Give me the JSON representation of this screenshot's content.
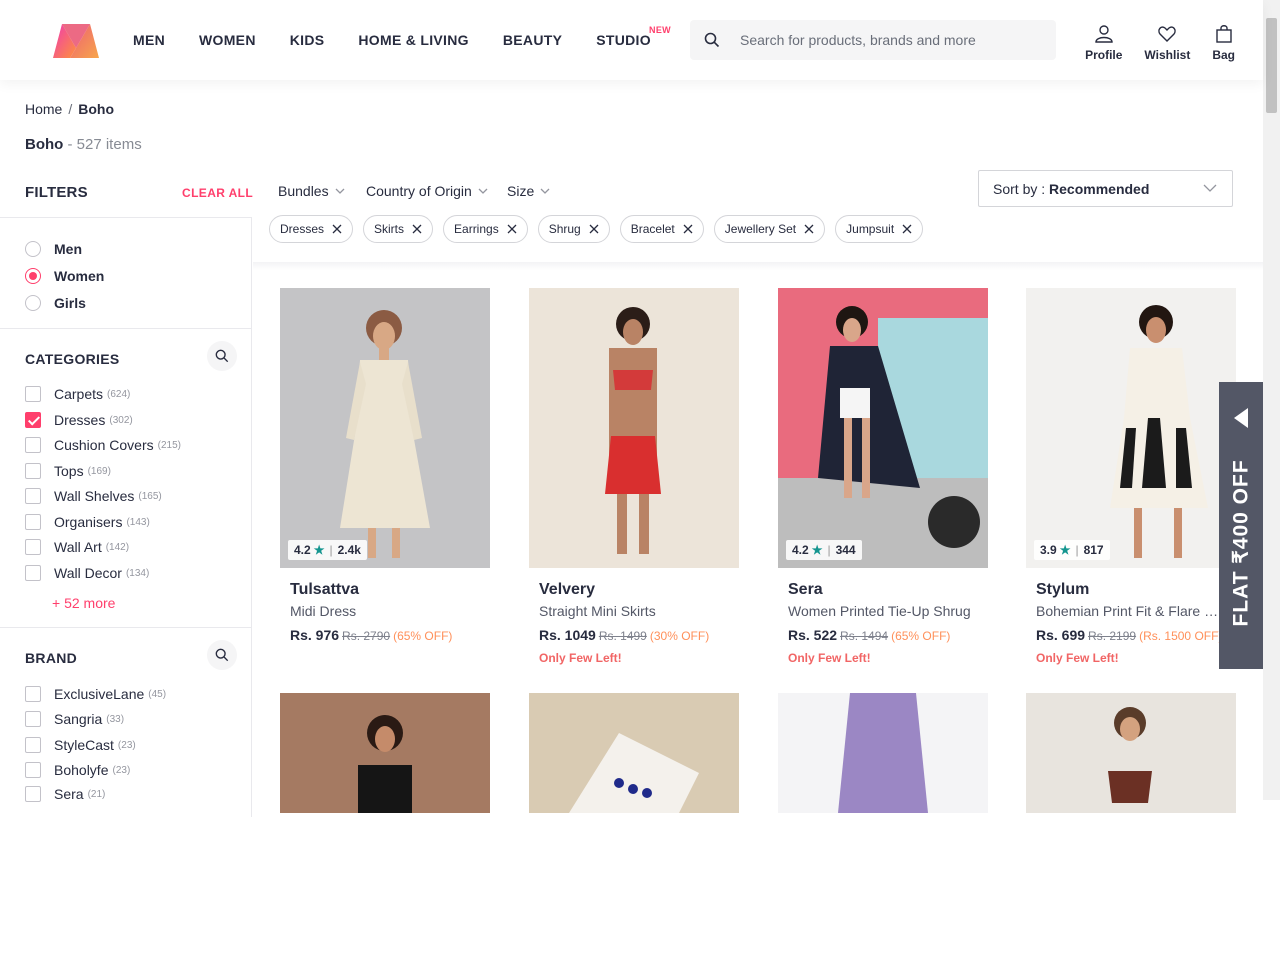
{
  "colors": {
    "accent": "#ff3f6c",
    "rating_star": "#14958f",
    "offer": "#ff905a",
    "low_stock": "#f16565"
  },
  "nav": {
    "items": [
      "MEN",
      "WOMEN",
      "KIDS",
      "HOME & LIVING",
      "BEAUTY",
      "STUDIO"
    ],
    "studio_badge": "NEW"
  },
  "search": {
    "placeholder": "Search for products, brands and more"
  },
  "actions": {
    "profile": "Profile",
    "wishlist": "Wishlist",
    "bag": "Bag"
  },
  "breadcrumb": {
    "home": "Home",
    "separator": "/",
    "current": "Boho"
  },
  "title": {
    "name": "Boho",
    "count": " - 527 items"
  },
  "filters": {
    "heading": "FILTERS",
    "clear_all": "CLEAR ALL"
  },
  "gender": [
    {
      "label": "Men",
      "selected": false
    },
    {
      "label": "Women",
      "selected": true
    },
    {
      "label": "Girls",
      "selected": false
    }
  ],
  "categories": {
    "heading": "CATEGORIES",
    "more": "+ 52 more",
    "items": [
      {
        "label": "Carpets",
        "count": "(624)",
        "checked": false
      },
      {
        "label": "Dresses",
        "count": "(302)",
        "checked": true
      },
      {
        "label": "Cushion Covers",
        "count": "(215)",
        "checked": false
      },
      {
        "label": "Tops",
        "count": "(169)",
        "checked": false
      },
      {
        "label": "Wall Shelves",
        "count": "(165)",
        "checked": false
      },
      {
        "label": "Organisers",
        "count": "(143)",
        "checked": false
      },
      {
        "label": "Wall Art",
        "count": "(142)",
        "checked": false
      },
      {
        "label": "Wall Decor",
        "count": "(134)",
        "checked": false
      }
    ]
  },
  "brand": {
    "heading": "BRAND",
    "items": [
      {
        "label": "ExclusiveLane",
        "count": "(45)"
      },
      {
        "label": "Sangria",
        "count": "(33)"
      },
      {
        "label": "StyleCast",
        "count": "(23)"
      },
      {
        "label": "Boholyfe",
        "count": "(23)"
      },
      {
        "label": "Sera",
        "count": "(21)"
      }
    ]
  },
  "top_filters": [
    "Bundles",
    "Country of Origin",
    "Size"
  ],
  "sort": {
    "label": "Sort by : ",
    "value": "Recommended"
  },
  "chips": [
    "Dresses",
    "Skirts",
    "Earrings",
    "Shrug",
    "Bracelet",
    "Jewellery Set",
    "Jumpsuit"
  ],
  "products": [
    {
      "brand": "Tulsattva",
      "desc": "Midi Dress",
      "price": "Rs. 976",
      "mrp": "Rs. 2790",
      "off": "(65% OFF)",
      "rating": "4.2",
      "reviews": "2.4k",
      "few": ""
    },
    {
      "brand": "Velvery",
      "desc": "Straight Mini Skirts",
      "price": "Rs. 1049",
      "mrp": "Rs. 1499",
      "off": "(30% OFF)",
      "rating": "",
      "reviews": "",
      "few": "Only Few Left!"
    },
    {
      "brand": "Sera",
      "desc": "Women Printed Tie-Up Shrug",
      "price": "Rs. 522",
      "mrp": "Rs. 1494",
      "off": "(65% OFF)",
      "rating": "4.2",
      "reviews": "344",
      "few": "Only Few Left!"
    },
    {
      "brand": "Stylum",
      "desc": "Bohemian Print Fit & Flare Fla...",
      "price": "Rs. 699",
      "mrp": "Rs. 2199",
      "off": "(Rs. 1500 OFF)",
      "rating": "3.9",
      "reviews": "817",
      "few": "Only Few Left!"
    }
  ],
  "promo": {
    "text": "FLAT ₹400 OFF"
  }
}
